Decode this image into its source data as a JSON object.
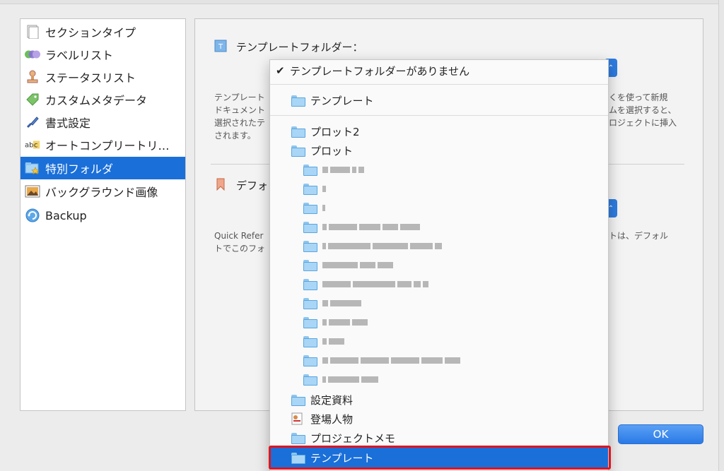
{
  "sidebar": {
    "items": [
      {
        "label": "セクションタイプ",
        "icon": "section-type-icon"
      },
      {
        "label": "ラベルリスト",
        "icon": "label-list-icon"
      },
      {
        "label": "ステータスリスト",
        "icon": "status-stamp-icon"
      },
      {
        "label": "カスタムメタデータ",
        "icon": "tag-icon"
      },
      {
        "label": "書式設定",
        "icon": "brush-icon"
      },
      {
        "label": "オートコンプリートリ…",
        "icon": "abc-icon"
      },
      {
        "label": "特別フォルダ",
        "icon": "special-folder-icon",
        "selected": true
      },
      {
        "label": "バックグラウンド画像",
        "icon": "image-icon"
      },
      {
        "label": "Backup",
        "icon": "backup-icon"
      }
    ]
  },
  "main": {
    "template_section": {
      "title": "テンプレートフォルダー：",
      "desc_left": [
        "テンプレート",
        "ドキュメント",
        "選択されたテ",
        "されます。"
      ],
      "desc_right": [
        "くを使って新規",
        "ムを選択すると、",
        "ロジェクトに挿入"
      ]
    },
    "default_section": {
      "title": "デフォ",
      "desc_left": [
        "Quick Refer",
        "トでこのフォ"
      ],
      "desc_right": [
        "トは、デフォル"
      ]
    },
    "ok_label": "OK"
  },
  "dropdown": {
    "checked_item": "テンプレートフォルダーがありません",
    "first_folder": "テンプレート",
    "plot2": "プロット2",
    "plot": "プロット",
    "setting_docs": "設定資料",
    "characters": "登場人物",
    "project_memo": "プロジェクトメモ",
    "selected_item": "テンプレート"
  },
  "colors": {
    "accent": "#1a6fd9",
    "highlight_border": "#e0141e"
  }
}
